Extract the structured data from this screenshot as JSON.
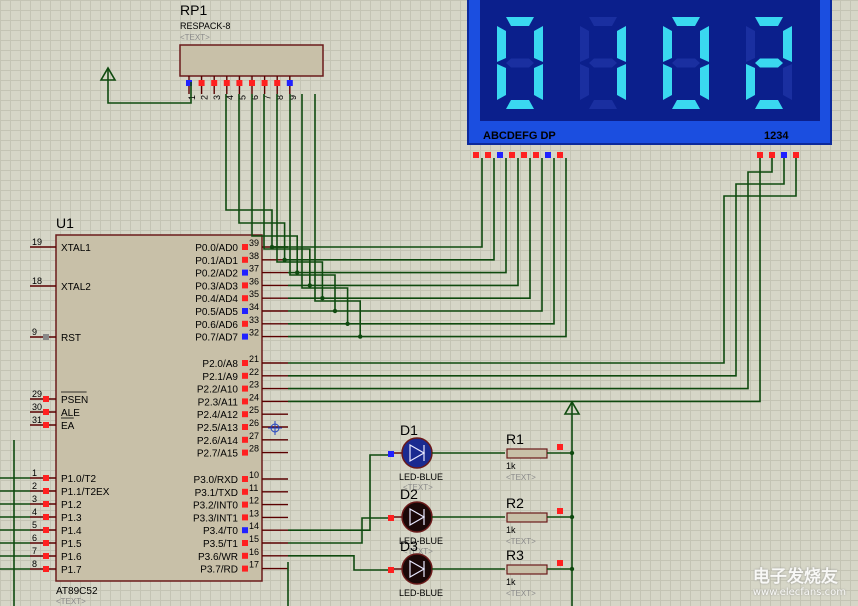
{
  "rp1": {
    "ref": "RP1",
    "value": "RESPACK-8",
    "text": "<TEXT>",
    "pins": [
      "1",
      "2",
      "3",
      "4",
      "5",
      "6",
      "7",
      "8",
      "9"
    ]
  },
  "display": {
    "digits": [
      "0",
      "1",
      "0",
      "2"
    ],
    "segments_label": "ABCDEFG  DP",
    "common_label": "1234"
  },
  "u1": {
    "ref": "U1",
    "part": "AT89C52",
    "text": "<TEXT>",
    "left_pins": [
      {
        "name": "XTAL1",
        "num": "19"
      },
      {
        "name": "XTAL2",
        "num": "18"
      },
      {
        "name": "RST",
        "num": "9"
      },
      {
        "name": "PSEN",
        "num": "29"
      },
      {
        "name": "ALE",
        "num": "30"
      },
      {
        "name": "EA",
        "num": "31"
      },
      {
        "name": "P1.0/T2",
        "num": "1"
      },
      {
        "name": "P1.1/T2EX",
        "num": "2"
      },
      {
        "name": "P1.2",
        "num": "3"
      },
      {
        "name": "P1.3",
        "num": "4"
      },
      {
        "name": "P1.4",
        "num": "5"
      },
      {
        "name": "P1.5",
        "num": "6"
      },
      {
        "name": "P1.6",
        "num": "7"
      },
      {
        "name": "P1.7",
        "num": "8"
      }
    ],
    "right_pins": [
      {
        "name": "P0.0/AD0",
        "num": "39"
      },
      {
        "name": "P0.1/AD1",
        "num": "38"
      },
      {
        "name": "P0.2/AD2",
        "num": "37"
      },
      {
        "name": "P0.3/AD3",
        "num": "36"
      },
      {
        "name": "P0.4/AD4",
        "num": "35"
      },
      {
        "name": "P0.5/AD5",
        "num": "34"
      },
      {
        "name": "P0.6/AD6",
        "num": "33"
      },
      {
        "name": "P0.7/AD7",
        "num": "32"
      },
      {
        "name": "P2.0/A8",
        "num": "21"
      },
      {
        "name": "P2.1/A9",
        "num": "22"
      },
      {
        "name": "P2.2/A10",
        "num": "23"
      },
      {
        "name": "P2.3/A11",
        "num": "24"
      },
      {
        "name": "P2.4/A12",
        "num": "25"
      },
      {
        "name": "P2.5/A13",
        "num": "26"
      },
      {
        "name": "P2.6/A14",
        "num": "27"
      },
      {
        "name": "P2.7/A15",
        "num": "28"
      },
      {
        "name": "P3.0/RXD",
        "num": "10"
      },
      {
        "name": "P3.1/TXD",
        "num": "11"
      },
      {
        "name": "P3.2/INT0",
        "num": "12"
      },
      {
        "name": "P3.3/INT1",
        "num": "13"
      },
      {
        "name": "P3.4/T0",
        "num": "14"
      },
      {
        "name": "P3.5/T1",
        "num": "15"
      },
      {
        "name": "P3.6/WR",
        "num": "16"
      },
      {
        "name": "P3.7/RD",
        "num": "17"
      }
    ]
  },
  "leds": [
    {
      "ref": "D1",
      "value": "LED-BLUE",
      "text": "<TEXT>"
    },
    {
      "ref": "D2",
      "value": "LED-BLUE",
      "text": "<TEXT>"
    },
    {
      "ref": "D3",
      "value": "LED-BLUE",
      "text": ""
    }
  ],
  "resistors": [
    {
      "ref": "R1",
      "value": "1k",
      "text": "<TEXT>"
    },
    {
      "ref": "R2",
      "value": "1k",
      "text": "<TEXT>"
    },
    {
      "ref": "R3",
      "value": "1k",
      "text": "<TEXT>"
    }
  ],
  "watermark": {
    "title": "电子发烧友",
    "url": "www.elecfans.com"
  },
  "colors": {
    "background": "#d6d6c7",
    "chip_body": "#c8c0a8",
    "wire": "#0f4a0f",
    "display_frame": "#1b4ee0",
    "display_face": "#0b1f8c",
    "segment_on": "#3ad8f0",
    "pin_high": "#ff2020",
    "pin_low": "#2020ff"
  }
}
